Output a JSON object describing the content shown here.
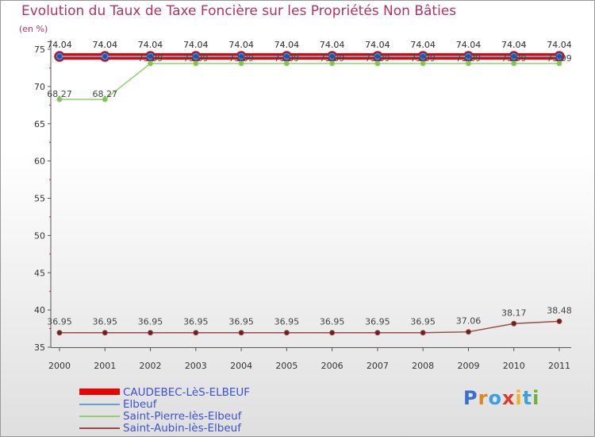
{
  "title": "Evolution du Taux de Taxe Foncière sur les Propriétés Non Bâties",
  "unit_label": "(en %)",
  "logo": {
    "text": "Proxiti",
    "colors": [
      "#3a6fd0",
      "#e0861c",
      "#3aa0e0",
      "#e03a2a",
      "#f0b020",
      "#3aa0e0",
      "#70b030"
    ]
  },
  "chart_data": {
    "type": "line",
    "title": "Evolution du Taux de Taxe Foncière sur les Propriétés Non Bâties",
    "ylabel": "(en %)",
    "ylim": [
      35,
      75
    ],
    "yticks": [
      35,
      40,
      45,
      50,
      55,
      60,
      65,
      70,
      75
    ],
    "categories": [
      "2000",
      "2001",
      "2002",
      "2003",
      "2004",
      "2005",
      "2006",
      "2007",
      "2008",
      "2009",
      "2010",
      "2011"
    ],
    "grid": false,
    "legend_position": "bottom-left",
    "series": [
      {
        "name": "CAUDEBEC-LèS-ELBEUF",
        "color": "#ee0000",
        "values": [
          74.04,
          74.04,
          74.04,
          74.04,
          74.04,
          74.04,
          74.04,
          74.04,
          74.04,
          74.04,
          74.04,
          74.04
        ],
        "labels": [
          "74.04",
          "74.04",
          "74.04",
          "74.04",
          "74.04",
          "74.04",
          "74.04",
          "74.04",
          "74.04",
          "74.04",
          "74.04",
          "74.04"
        ]
      },
      {
        "name": "Elbeuf",
        "color": "#6aa0c8",
        "values": [
          74.04,
          74.04,
          74.04,
          74.04,
          74.04,
          74.04,
          74.04,
          74.04,
          74.04,
          74.04,
          74.04,
          74.04
        ],
        "labels": [
          "74.04",
          "74.04",
          "74.04",
          "74.04",
          "74.04",
          "74.04",
          "74.04",
          "74.04",
          "74.04",
          "74.04",
          "74.04",
          "74.04"
        ]
      },
      {
        "name": "Saint-Pierre-lès-Elbeuf",
        "color": "#90d070",
        "values": [
          68.27,
          68.27,
          73.09,
          73.09,
          73.09,
          73.09,
          73.09,
          73.09,
          73.09,
          73.09,
          73.09,
          73.09
        ],
        "labels": [
          "68.27",
          "68.27",
          "73.09",
          "73.09",
          "73.09",
          "73.09",
          "73.09",
          "73.09",
          "73.09",
          "73.09",
          "73.09",
          "73.09"
        ]
      },
      {
        "name": "Saint-Aubin-lès-Elbeuf",
        "color": "#9a4a4a",
        "values": [
          36.95,
          36.95,
          36.95,
          36.95,
          36.95,
          36.95,
          36.95,
          36.95,
          36.95,
          37.06,
          38.17,
          38.48
        ],
        "labels": [
          "36.95",
          "36.95",
          "36.95",
          "36.95",
          "36.95",
          "36.95",
          "36.95",
          "36.95",
          "36.95",
          "37.06",
          "38.17",
          "38.48"
        ]
      }
    ]
  }
}
